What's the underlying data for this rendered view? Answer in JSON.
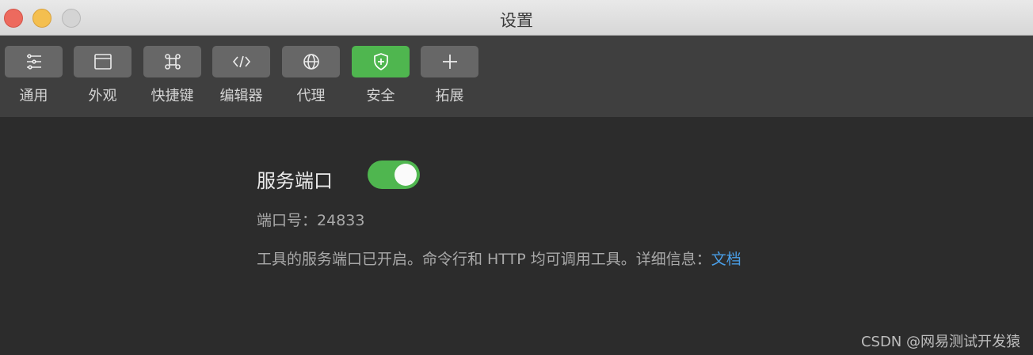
{
  "window": {
    "title": "设置"
  },
  "toolbar": {
    "items": [
      {
        "label": "通用",
        "icon": "sliders-icon",
        "active": false
      },
      {
        "label": "外观",
        "icon": "window-icon",
        "active": false
      },
      {
        "label": "快捷键",
        "icon": "command-key-icon",
        "active": false
      },
      {
        "label": "编辑器",
        "icon": "code-icon",
        "active": false
      },
      {
        "label": "代理",
        "icon": "globe-icon",
        "active": false
      },
      {
        "label": "安全",
        "icon": "shield-icon",
        "active": true
      },
      {
        "label": "拓展",
        "icon": "plus-icon",
        "active": false
      }
    ]
  },
  "security": {
    "service_port_label": "服务端口",
    "service_port_enabled": true,
    "port_prefix": "端口号：",
    "port_value": "24833",
    "info_text": "工具的服务端口已开启。命令行和 HTTP 均可调用工具。详细信息：",
    "doc_link": "文档"
  },
  "watermark": "CSDN @网易测试开发猿",
  "colors": {
    "accent": "#4fb64f",
    "link": "#4a9fe8"
  }
}
